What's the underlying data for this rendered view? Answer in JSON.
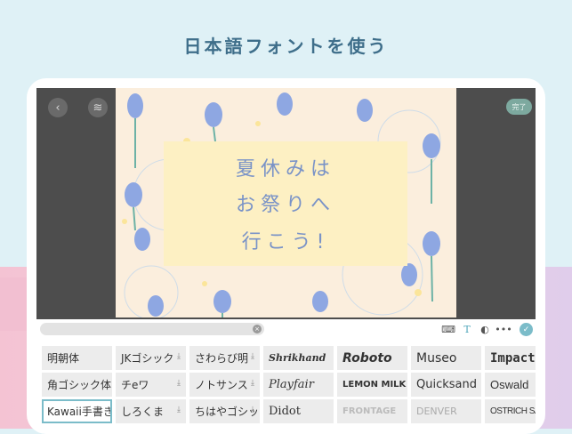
{
  "headline": "日本語フォントを使う",
  "editor": {
    "done_label": "完了",
    "poster_lines": [
      "夏休みは",
      "お祭りへ",
      "行こう!"
    ]
  },
  "toolbar": {
    "search_value": "",
    "icons": [
      "back-icon",
      "layers-icon",
      "keyboard-icon",
      "text-icon",
      "palette-icon",
      "more-icon",
      "check-icon"
    ]
  },
  "fonts": [
    [
      {
        "label": "明朝体"
      },
      {
        "label": "JKゴシック",
        "dl": true
      },
      {
        "label": "さわらび明",
        "dl": true
      },
      {
        "label": "Shrikhand"
      },
      {
        "label": "Roboto"
      },
      {
        "label": "Museo"
      },
      {
        "label": "Impact"
      }
    ],
    [
      {
        "label": "角ゴシック体"
      },
      {
        "label": "チeワ",
        "dl": true
      },
      {
        "label": "ノトサンス",
        "dl": true
      },
      {
        "label": "Playfair"
      },
      {
        "label": "LEMON MILK"
      },
      {
        "label": "Quicksand"
      },
      {
        "label": "Oswald"
      }
    ],
    [
      {
        "label": "Kawaii手書き",
        "selected": true
      },
      {
        "label": "しろくま",
        "dl": true
      },
      {
        "label": "ちはやゴシック",
        "dl": true
      },
      {
        "label": "Didot"
      },
      {
        "label": "FRONTAGE"
      },
      {
        "label": "DENVER"
      },
      {
        "label": "OSTRICH SANS"
      }
    ]
  ],
  "download_glyph": "⤓",
  "colors": {
    "accent": "#7bbcc9",
    "headline": "#3e6e8a",
    "poster_text": "#7a93c7"
  }
}
